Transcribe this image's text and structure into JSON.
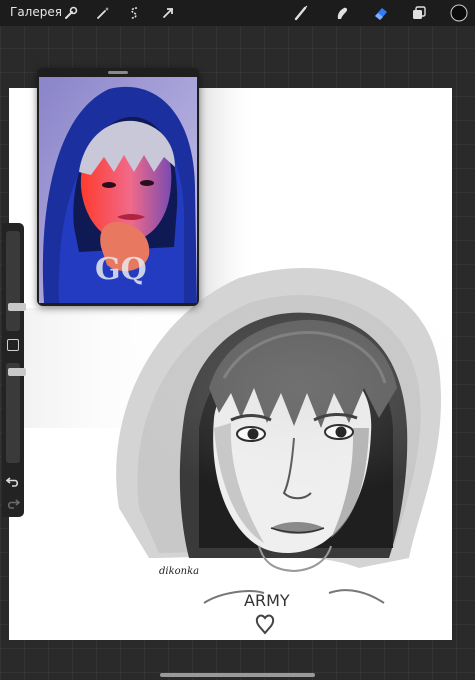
{
  "toolbar": {
    "gallery_label": "Галерея",
    "left_tools": [
      "wrench-icon",
      "magic-wand-icon",
      "selection-icon",
      "transform-arrow-icon"
    ],
    "right_tools": [
      "brush-icon",
      "smudge-icon",
      "eraser-icon",
      "layers-icon"
    ],
    "active_tool": "eraser-icon",
    "current_color": "#0b0b0b",
    "accent": "#2f7df6"
  },
  "sidebar": {
    "brush_size_level": 0.22,
    "opacity_level": 0.95,
    "buttons": [
      "modify-square-icon",
      "undo-icon",
      "redo-icon"
    ]
  },
  "reference": {
    "magazine_label": "GQ"
  },
  "artwork": {
    "signature": "dikonka",
    "shirt_letters": "ARMY"
  }
}
